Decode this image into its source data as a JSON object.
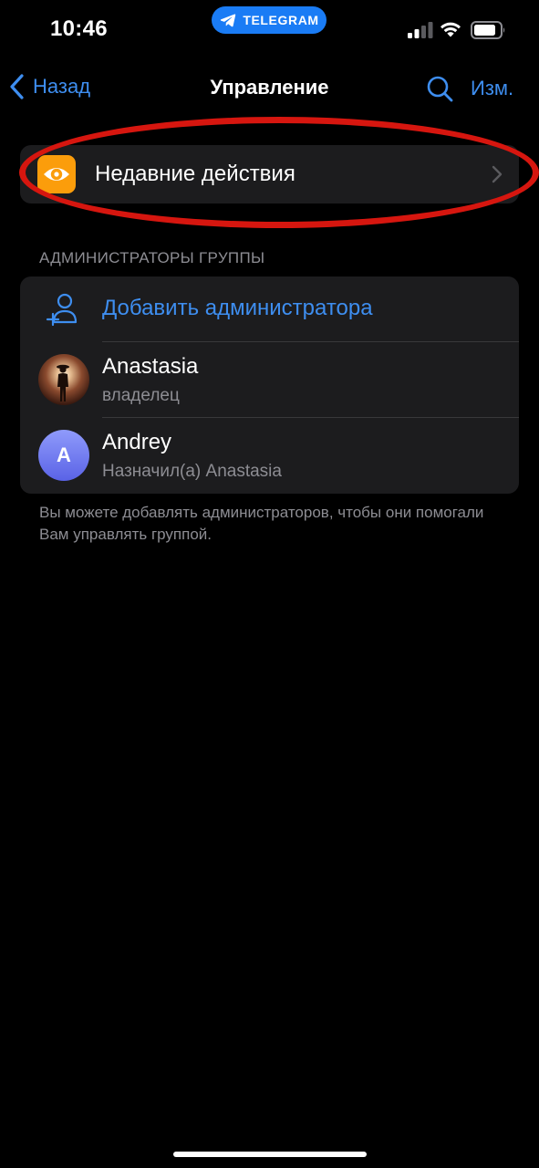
{
  "status_bar": {
    "time": "10:46",
    "app_pill": "TELEGRAM",
    "pill_color": "#1a7cf5"
  },
  "nav": {
    "back_label": "Назад",
    "title": "Управление",
    "edit_label": "Изм.",
    "accent_color": "#3e8ef0"
  },
  "recent_actions": {
    "label": "Недавние действия",
    "icon": "eye-icon",
    "icon_bg": "#fb9d0b"
  },
  "admins_section": {
    "header": "АДМИНИСТРАТОРЫ ГРУППЫ",
    "add_label": "Добавить администратора",
    "admins": [
      {
        "name": "Anastasia",
        "subtitle": "владелец",
        "avatar": "photo"
      },
      {
        "name": "Andrey",
        "subtitle": "Назначил(а) Anastasia",
        "avatar_letter": "A"
      }
    ],
    "footer": "Вы можете добавлять администраторов, чтобы они помогали Вам управлять группой."
  }
}
